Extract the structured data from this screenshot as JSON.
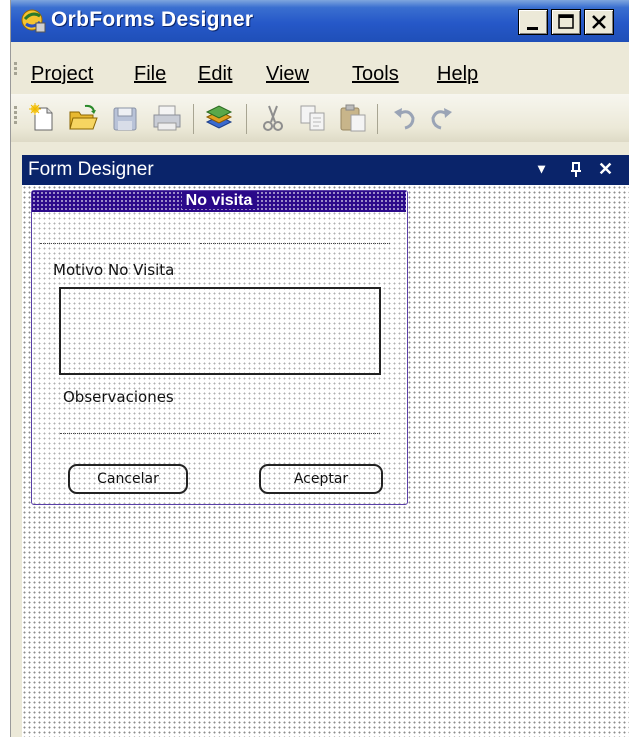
{
  "window": {
    "title": "OrbForms Designer",
    "minimize_label": "_",
    "maximize_label": "□",
    "close_label": "✕"
  },
  "menu": {
    "items": [
      {
        "label": "Project"
      },
      {
        "label": "File"
      },
      {
        "label": "Edit"
      },
      {
        "label": "View"
      },
      {
        "label": "Tools"
      },
      {
        "label": "Help"
      }
    ]
  },
  "toolbar": {
    "icons": [
      "new-file-icon",
      "open-folder-icon",
      "save-icon",
      "print-icon",
      "stack-icon",
      "cut-icon",
      "copy-icon",
      "paste-icon",
      "undo-icon",
      "redo-icon"
    ]
  },
  "panel": {
    "title": "Form Designer",
    "dropdown_glyph": "▾",
    "pin_glyph": "ᵖ",
    "close_glyph": "✕"
  },
  "form": {
    "title": "No visita",
    "motivo_label": "Motivo No Visita",
    "observaciones_label": "Observaciones",
    "cancel_button": "Cancelar",
    "accept_button": "Aceptar"
  },
  "colors": {
    "titlebar": "#2658c8",
    "panel_header": "#0a246a",
    "form_title": "#2b0a8a",
    "form_border": "#5a3fa8"
  }
}
